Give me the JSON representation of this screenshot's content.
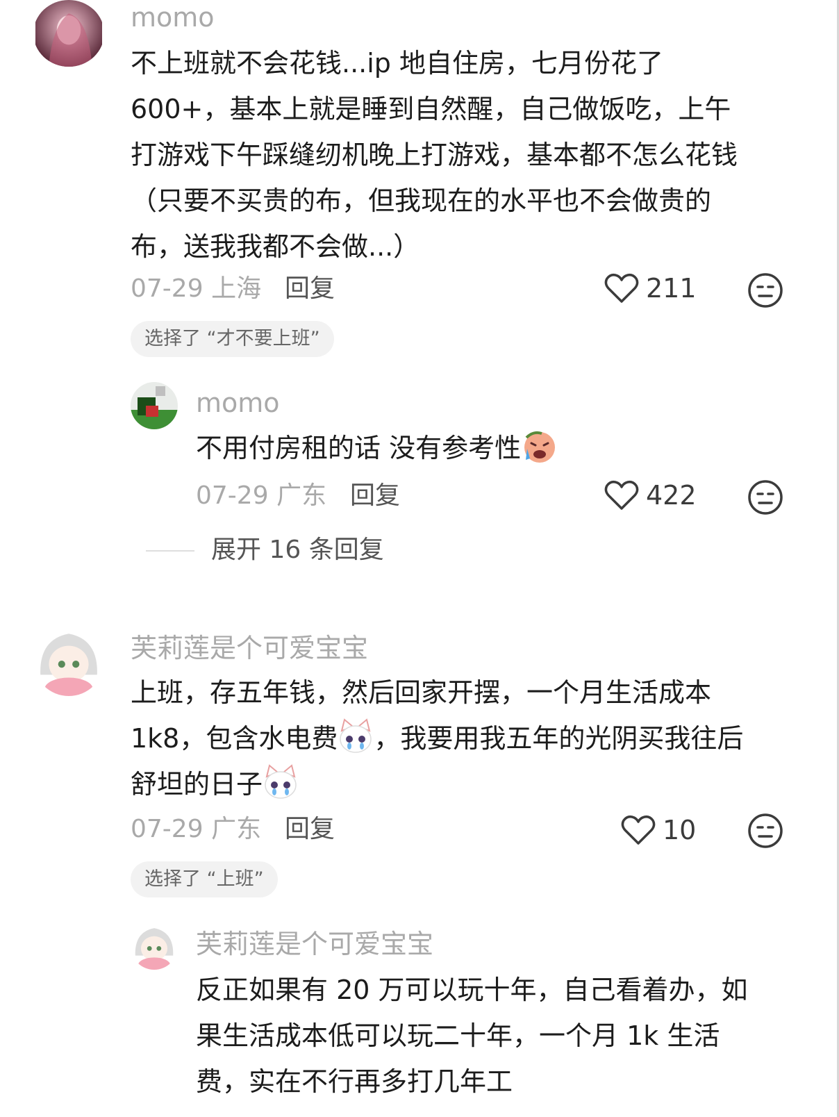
{
  "comments": [
    {
      "user": "momo",
      "lines": [
        "不上班就不会花钱...ip 地自住房，七月份花了",
        "600+，基本上就是睡到自然醒，自己做饭吃，上午",
        "打游戏下午踩缝纫机晚上打游戏，基本都不怎么花钱",
        "（只要不买贵的布，但我现在的水平也不会做贵的",
        "布，送我我都不会做...）"
      ],
      "date": "07-29",
      "location": "上海",
      "reply_label": "回复",
      "likes": "211",
      "tag": "选择了 “才不要上班”",
      "replies": [
        {
          "user": "momo",
          "text": "不用付房租的话 没有参考性",
          "emoji": "crying-face-icon",
          "date": "07-29",
          "location": "广东",
          "reply_label": "回复",
          "likes": "422"
        }
      ],
      "expand_label": "展开 16 条回复"
    },
    {
      "user": "芙莉莲是个可爱宝宝",
      "line1": "上班，存五年钱，然后回家开摆，一个月生活成本",
      "line2_a": "1k8，包含水电费",
      "line2_b": "，我要用我五年的光阴买我往后",
      "line3": "舒坦的日子",
      "emoji": "crying-cat-icon",
      "date": "07-29",
      "location": "广东",
      "reply_label": "回复",
      "likes": "10",
      "tag": "选择了 “上班”",
      "replies": [
        {
          "user": "芙莉莲是个可爱宝宝",
          "lines": [
            "反正如果有 20 万可以玩十年，自己看着办，如",
            "果生活成本低可以玩二十年，一个月 1k 生活",
            "费，实在不行再多打几年工"
          ]
        }
      ]
    }
  ],
  "colors": {
    "name": "#a9a9a9",
    "text": "#1c1c1c",
    "tag_bg": "#f2f2f2"
  }
}
